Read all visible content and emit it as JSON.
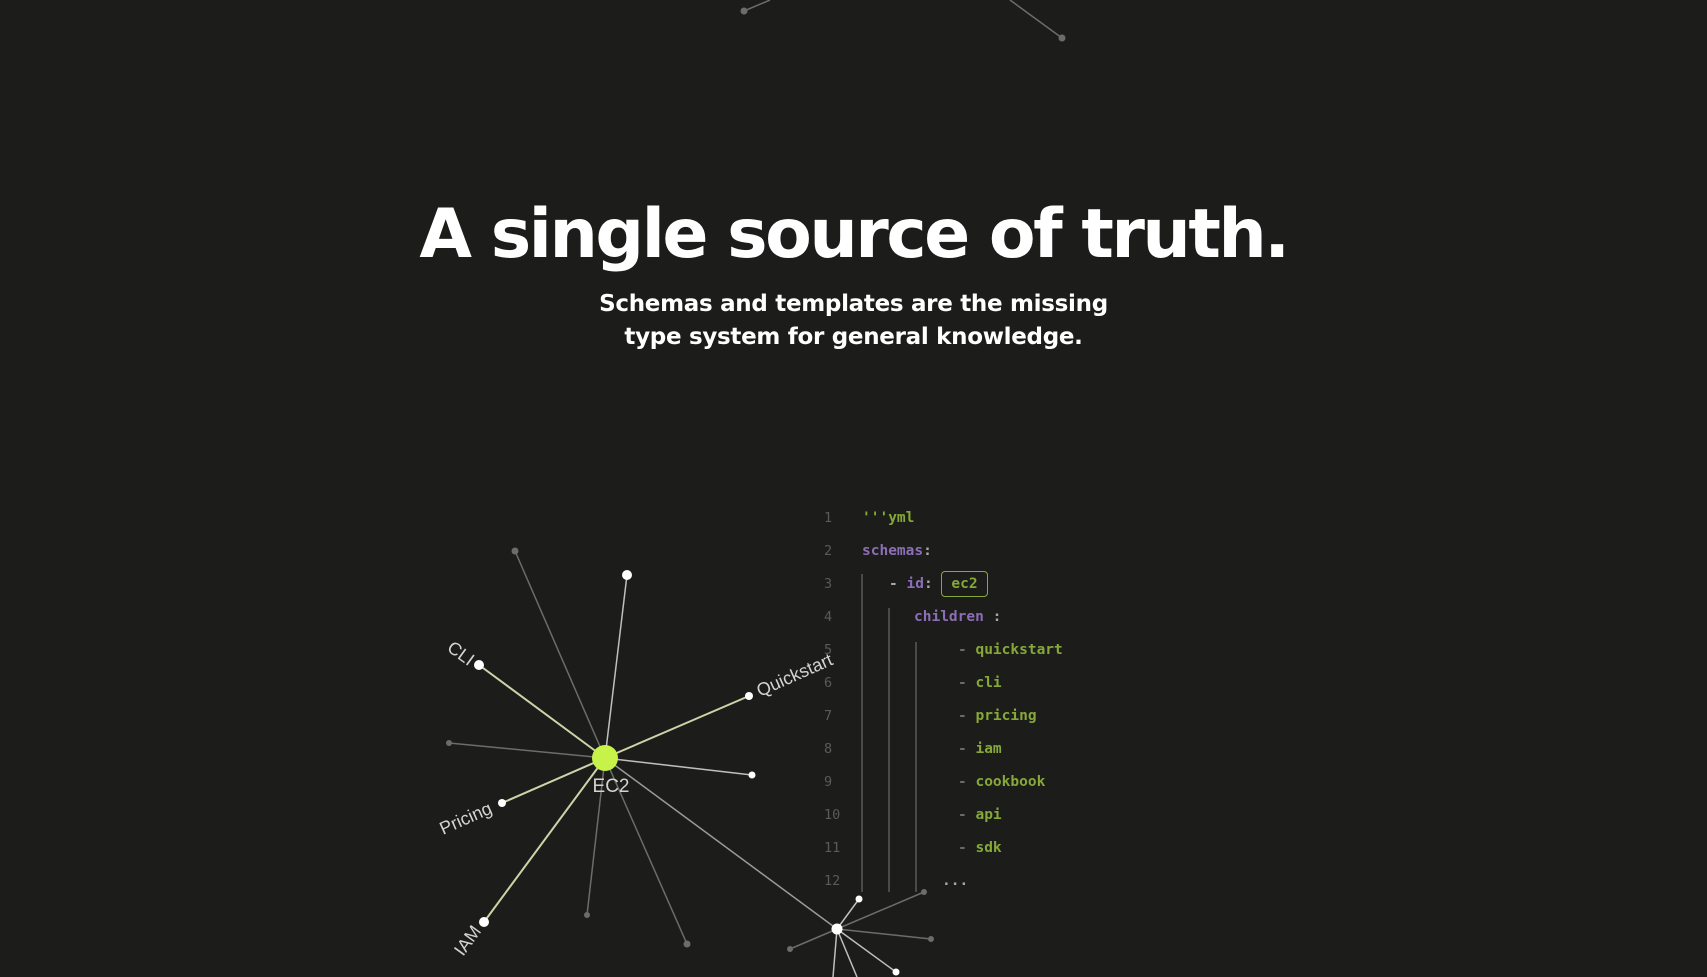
{
  "hero": {
    "title": "A single source of truth.",
    "subtitle": "Schemas and templates are the missing type system for general knowledge."
  },
  "graph": {
    "center_label": "EC2",
    "labels": {
      "cli": "CLI",
      "quickstart": "Quickstart",
      "pricing": "Pricing",
      "iam": "IAM"
    },
    "colors": {
      "center": "#c6f24a",
      "active_edge": "#cfd3a8",
      "dim_edge": "#6c6d68"
    }
  },
  "code": {
    "lines": [
      {
        "n": "1",
        "segments": [
          {
            "t": "'''yml",
            "c": "green"
          }
        ]
      },
      {
        "n": "2",
        "segments": [
          {
            "t": "schemas",
            "c": "purple"
          },
          {
            "t": ":",
            "c": "gray"
          }
        ]
      },
      {
        "n": "3",
        "segments": [
          {
            "t": "- ",
            "c": "gray"
          },
          {
            "t": "id",
            "c": "purple"
          },
          {
            "t": ": ",
            "c": "gray"
          },
          {
            "t": "ec2",
            "c": "boxed"
          }
        ]
      },
      {
        "n": "4",
        "segments": [
          {
            "t": "children",
            "c": "purple"
          },
          {
            "t": " :",
            "c": "gray"
          }
        ]
      },
      {
        "n": "5",
        "segments": [
          {
            "t": "- ",
            "c": "dash"
          },
          {
            "t": "quickstart",
            "c": "green"
          }
        ]
      },
      {
        "n": "6",
        "segments": [
          {
            "t": "- ",
            "c": "dash"
          },
          {
            "t": "cli",
            "c": "green"
          }
        ]
      },
      {
        "n": "7",
        "segments": [
          {
            "t": "- ",
            "c": "dash"
          },
          {
            "t": "pricing",
            "c": "green"
          }
        ]
      },
      {
        "n": "8",
        "segments": [
          {
            "t": "- ",
            "c": "dash"
          },
          {
            "t": "iam",
            "c": "green"
          }
        ]
      },
      {
        "n": "9",
        "segments": [
          {
            "t": "- ",
            "c": "dash"
          },
          {
            "t": "cookbook",
            "c": "green"
          }
        ]
      },
      {
        "n": "10",
        "segments": [
          {
            "t": "- ",
            "c": "dash"
          },
          {
            "t": "api",
            "c": "green"
          }
        ]
      },
      {
        "n": "11",
        "segments": [
          {
            "t": "- ",
            "c": "dash"
          },
          {
            "t": "sdk",
            "c": "green"
          }
        ]
      },
      {
        "n": "12",
        "segments": [
          {
            "t": "...",
            "c": "gray"
          }
        ]
      }
    ]
  }
}
